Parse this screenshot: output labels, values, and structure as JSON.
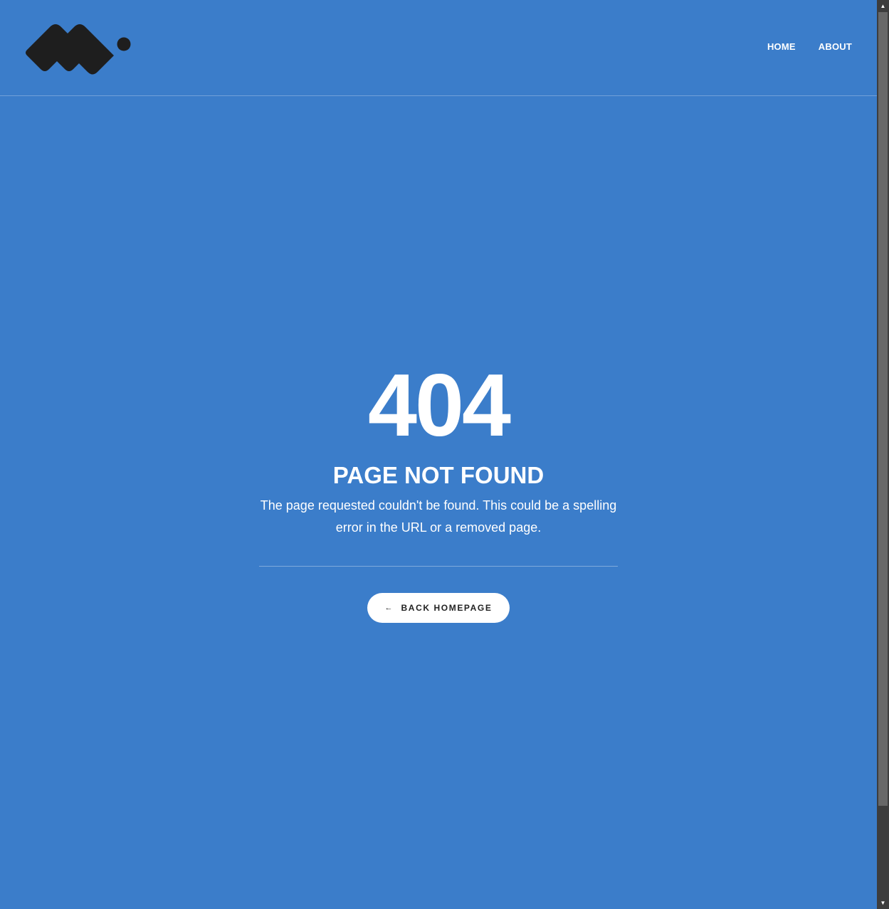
{
  "header": {
    "logo_icon": "mountain-wave-logo",
    "nav": [
      {
        "label": "HOME"
      },
      {
        "label": "ABOUT"
      }
    ]
  },
  "error": {
    "code": "404",
    "title": "PAGE NOT FOUND",
    "description": "The page requested couldn't be found. This could be a spelling error in the URL or a removed page."
  },
  "back_button": {
    "icon": "arrow-left-icon",
    "arrow": "←",
    "label": "BACK HOMEPAGE"
  },
  "colors": {
    "background": "#3b7dca",
    "text": "#ffffff",
    "logo": "#1e1e1e",
    "button_bg": "#ffffff"
  }
}
